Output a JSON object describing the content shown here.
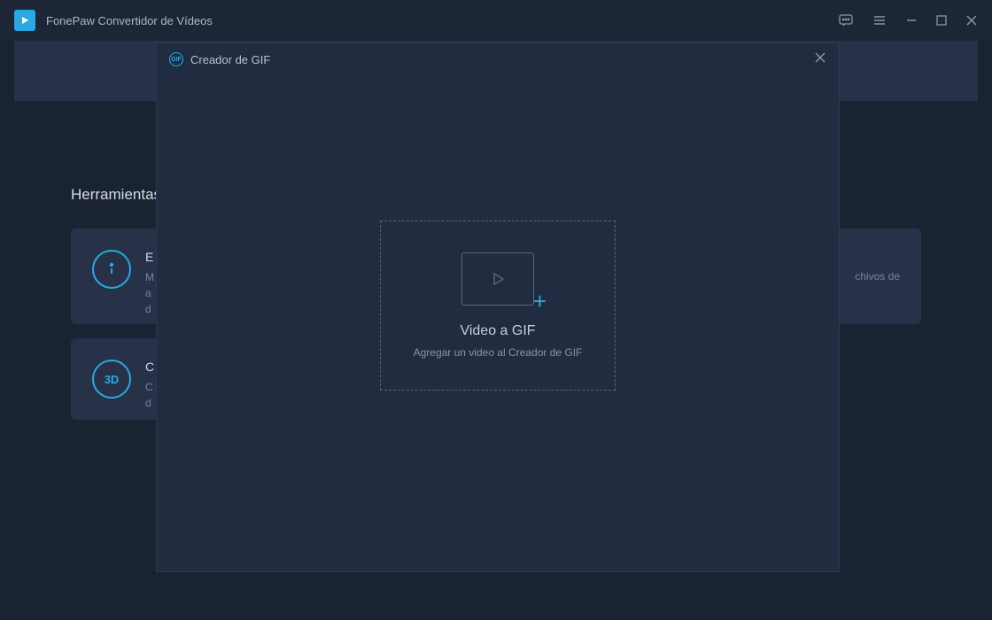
{
  "app": {
    "title": "FonePaw Convertidor de Vídeos"
  },
  "main": {
    "section_title": "Herramientas"
  },
  "tools": {
    "card1": {
      "title": "E",
      "desc": "M\na\nd"
    },
    "card2": {
      "label_3d": "3D",
      "title": "C",
      "desc": "C\nd"
    },
    "right_peek": "chivos de"
  },
  "modal": {
    "title": "Creador de GIF",
    "gif_badge": "GIF",
    "dropzone": {
      "title": "Video a GIF",
      "subtitle": "Agregar un video al Creador de GIF"
    }
  }
}
